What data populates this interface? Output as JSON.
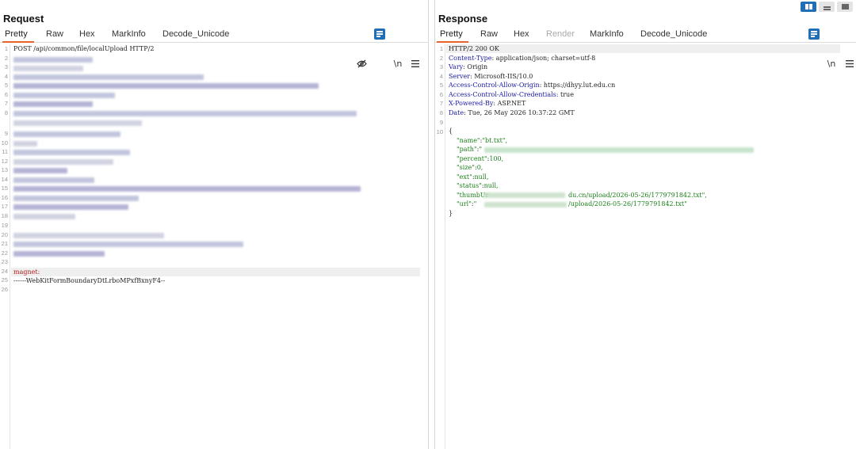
{
  "request": {
    "title": "Request",
    "tabs": [
      "Pretty",
      "Raw",
      "Hex",
      "MarkInfo",
      "Decode_Unicode"
    ],
    "toolbar": {
      "newline_label": "\\n",
      "menu_icon": "hamburger-icon",
      "hide_icon": "eye-off-icon",
      "wrap_icon": "wrap-lines-icon"
    },
    "lines": {
      "l1": "POST /api/common/file/localUpload HTTP/2",
      "l24": "magnet:",
      "l25": "------WebKitFormBoundaryDtLrboMPxfBxnyF4--"
    },
    "line_numbers": [
      "1",
      "2",
      "3",
      "4",
      "5",
      "6",
      "7",
      "8",
      "",
      "9",
      "10",
      "11",
      "12",
      "13",
      "14",
      "15",
      "16",
      "17",
      "18",
      "19",
      "20",
      "21",
      "22",
      "23",
      "24",
      "25",
      "26"
    ]
  },
  "response": {
    "title": "Response",
    "tabs": [
      "Pretty",
      "Raw",
      "Hex",
      "Render",
      "MarkInfo",
      "Decode_Unicode"
    ],
    "toolbar": {
      "newline_label": "\\n",
      "menu_icon": "hamburger-icon",
      "wrap_icon": "wrap-lines-icon"
    },
    "headers": [
      {
        "k": "HTTP/2 200 OK",
        "v": ""
      },
      {
        "k": "Content-Type",
        "v": " application/json; charset=utf-8"
      },
      {
        "k": "Vary",
        "v": " Origin"
      },
      {
        "k": "Server",
        "v": " Microsoft-IIS/10.0"
      },
      {
        "k": "Access-Control-Allow-Origin",
        "v": " https://dhyy.lut.edu.cn"
      },
      {
        "k": "Access-Control-Allow-Credentials",
        "v": " true"
      },
      {
        "k": "X-Powered-By",
        "v": " ASP.NET"
      },
      {
        "k": "Date",
        "v": " Tue, 26 May 2026 10:37:22 GMT"
      }
    ],
    "json": {
      "open": "{",
      "name_key": "\"name\"",
      "name_val": "\"bt.txt\",",
      "path_key": "\"path\"",
      "path_val": "\"",
      "percent_key": "\"percent\"",
      "percent_val": "100,",
      "size_key": "\"size\"",
      "size_val": "0,",
      "ext_key": "\"ext\"",
      "ext_val": "null,",
      "status_key": "\"status\"",
      "status_val": "null,",
      "thumb_key": "\"thumbUr",
      "thumb_tail": "du.cn/upload/2026-05-26/1779791842.txt\",",
      "url_key": "\"url\"",
      "url_open": "\"",
      "url_tail": "/upload/2026-05-26/1779791842.txt\"",
      "close": "}"
    },
    "line_numbers": [
      "1",
      "2",
      "3",
      "4",
      "5",
      "6",
      "7",
      "8",
      "9",
      "10"
    ]
  },
  "layout_switch": [
    "split-view-icon",
    "horizontal-view-icon",
    "single-view-icon"
  ]
}
